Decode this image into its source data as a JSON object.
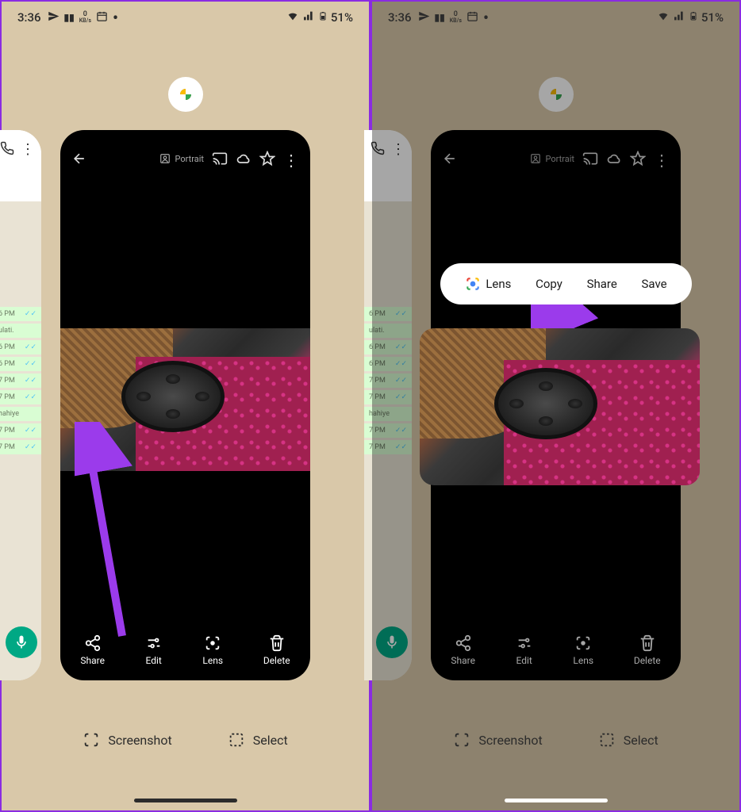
{
  "status": {
    "time": "3:36",
    "kbs_value": "0",
    "kbs_unit": "KB/s",
    "battery": "51%"
  },
  "viewer": {
    "portrait_label": "Portrait",
    "actions": {
      "share": "Share",
      "edit": "Edit",
      "lens": "Lens",
      "delete": "Delete"
    }
  },
  "recents": {
    "screenshot": "Screenshot",
    "select": "Select"
  },
  "chat_preview": {
    "rows": [
      {
        "text": "6 PM",
        "checks": "✓✓"
      },
      {
        "text": "ulati.",
        "checks": ""
      },
      {
        "text": "6 PM",
        "checks": "✓✓"
      },
      {
        "text": "6 PM",
        "checks": "✓✓"
      },
      {
        "text": "7 PM",
        "checks": "✓✓"
      },
      {
        "text": "7 PM",
        "checks": "✓✓"
      },
      {
        "text": "hahiye",
        "checks": ""
      },
      {
        "text": "7 PM",
        "checks": "✓✓"
      },
      {
        "text": "7 PM",
        "checks": "✓✓"
      }
    ]
  },
  "popup": {
    "lens": "Lens",
    "copy": "Copy",
    "share": "Share",
    "save": "Save"
  }
}
